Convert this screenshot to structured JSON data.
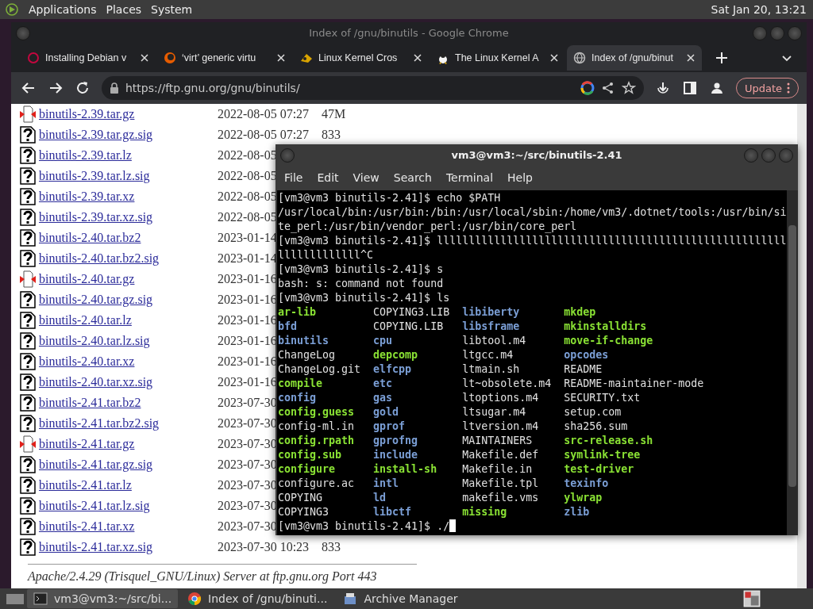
{
  "top_panel": {
    "menus": [
      "Applications",
      "Places",
      "System"
    ],
    "clock": "Sat Jan 20, 13:21"
  },
  "browser": {
    "title": "Index of /gnu/binutils - Google Chrome",
    "tabs": [
      {
        "label": "Installing Debian v",
        "selected": false
      },
      {
        "label": "‘virt’ generic virtu",
        "selected": false
      },
      {
        "label": "Linux Kernel Cros",
        "selected": false
      },
      {
        "label": "The Linux Kernel A",
        "selected": false
      },
      {
        "label": "Index of /gnu/binut",
        "selected": true
      }
    ],
    "address": "https://ftp.gnu.org/gnu/binutils/",
    "update_button": "Update",
    "listing": [
      {
        "name": "binutils-2.39.tar.gz",
        "kind": "archive",
        "date": "2022-08-05 07:27",
        "size": "47M"
      },
      {
        "name": "binutils-2.39.tar.gz.sig",
        "kind": "unknown",
        "date": "2022-08-05 07:27",
        "size": "833"
      },
      {
        "name": "binutils-2.39.tar.lz",
        "kind": "unknown",
        "date": "2022-08-05"
      },
      {
        "name": "binutils-2.39.tar.lz.sig",
        "kind": "unknown",
        "date": "2022-08-05"
      },
      {
        "name": "binutils-2.39.tar.xz",
        "kind": "unknown",
        "date": "2022-08-05"
      },
      {
        "name": "binutils-2.39.tar.xz.sig",
        "kind": "unknown",
        "date": "2022-08-05"
      },
      {
        "name": "binutils-2.40.tar.bz2",
        "kind": "unknown",
        "date": "2023-01-14"
      },
      {
        "name": "binutils-2.40.tar.bz2.sig",
        "kind": "unknown",
        "date": "2023-01-14"
      },
      {
        "name": "binutils-2.40.tar.gz",
        "kind": "archive",
        "date": "2023-01-16"
      },
      {
        "name": "binutils-2.40.tar.gz.sig",
        "kind": "unknown",
        "date": "2023-01-16"
      },
      {
        "name": "binutils-2.40.tar.lz",
        "kind": "unknown",
        "date": "2023-01-16"
      },
      {
        "name": "binutils-2.40.tar.lz.sig",
        "kind": "unknown",
        "date": "2023-01-16"
      },
      {
        "name": "binutils-2.40.tar.xz",
        "kind": "unknown",
        "date": "2023-01-16"
      },
      {
        "name": "binutils-2.40.tar.xz.sig",
        "kind": "unknown",
        "date": "2023-01-16"
      },
      {
        "name": "binutils-2.41.tar.bz2",
        "kind": "unknown",
        "date": "2023-07-30"
      },
      {
        "name": "binutils-2.41.tar.bz2.sig",
        "kind": "unknown",
        "date": "2023-07-30"
      },
      {
        "name": "binutils-2.41.tar.gz",
        "kind": "archive",
        "date": "2023-07-30"
      },
      {
        "name": "binutils-2.41.tar.gz.sig",
        "kind": "unknown",
        "date": "2023-07-30"
      },
      {
        "name": "binutils-2.41.tar.lz",
        "kind": "unknown",
        "date": "2023-07-30"
      },
      {
        "name": "binutils-2.41.tar.lz.sig",
        "kind": "unknown",
        "date": "2023-07-30"
      },
      {
        "name": "binutils-2.41.tar.xz",
        "kind": "unknown",
        "date": "2023-07-30"
      },
      {
        "name": "binutils-2.41.tar.xz.sig",
        "kind": "unknown",
        "date": "2023-07-30 10:23",
        "size": "833"
      }
    ],
    "footer": "Apache/2.4.29 (Trisquel_GNU/Linux) Server at ftp.gnu.org Port 443"
  },
  "terminal": {
    "title": "vm3@vm3:~/src/binutils-2.41",
    "menus": [
      "File",
      "Edit",
      "View",
      "Search",
      "Terminal",
      "Help"
    ],
    "lines": [
      "[vm3@vm3 binutils-2.41]$ echo $PATH",
      "/usr/local/bin:/usr/bin:/bin:/usr/local/sbin:/home/vm3/.dotnet/tools:/usr/bin/si",
      "te_perl:/usr/bin/vendor_perl:/usr/bin/core_perl",
      "[vm3@vm3 binutils-2.41]$ lllllllllllllllllllllllllllllllllllllllllllllllllllllll",
      "lllllllllllll^C",
      "[vm3@vm3 binutils-2.41]$ s",
      "bash: s: command not found",
      "[vm3@vm3 binutils-2.41]$ ls"
    ],
    "ls_rows": [
      [
        {
          "name": "ar-lib",
          "kind": "exec"
        },
        {
          "name": "COPYING3.LIB",
          "kind": "file"
        },
        {
          "name": "libiberty",
          "kind": "dir"
        },
        {
          "name": "mkdep",
          "kind": "exec"
        }
      ],
      [
        {
          "name": "bfd",
          "kind": "dir"
        },
        {
          "name": "COPYING.LIB",
          "kind": "file"
        },
        {
          "name": "libsframe",
          "kind": "dir"
        },
        {
          "name": "mkinstalldirs",
          "kind": "exec"
        }
      ],
      [
        {
          "name": "binutils",
          "kind": "dir"
        },
        {
          "name": "cpu",
          "kind": "dir"
        },
        {
          "name": "libtool.m4",
          "kind": "file"
        },
        {
          "name": "move-if-change",
          "kind": "exec"
        }
      ],
      [
        {
          "name": "ChangeLog",
          "kind": "file"
        },
        {
          "name": "depcomp",
          "kind": "exec"
        },
        {
          "name": "ltgcc.m4",
          "kind": "file"
        },
        {
          "name": "opcodes",
          "kind": "dir"
        }
      ],
      [
        {
          "name": "ChangeLog.git",
          "kind": "file"
        },
        {
          "name": "elfcpp",
          "kind": "dir"
        },
        {
          "name": "ltmain.sh",
          "kind": "file"
        },
        {
          "name": "README",
          "kind": "file"
        }
      ],
      [
        {
          "name": "compile",
          "kind": "exec"
        },
        {
          "name": "etc",
          "kind": "dir"
        },
        {
          "name": "lt~obsolete.m4",
          "kind": "file"
        },
        {
          "name": "README-maintainer-mode",
          "kind": "file"
        }
      ],
      [
        {
          "name": "config",
          "kind": "dir"
        },
        {
          "name": "gas",
          "kind": "dir"
        },
        {
          "name": "ltoptions.m4",
          "kind": "file"
        },
        {
          "name": "SECURITY.txt",
          "kind": "file"
        }
      ],
      [
        {
          "name": "config.guess",
          "kind": "exec"
        },
        {
          "name": "gold",
          "kind": "dir"
        },
        {
          "name": "ltsugar.m4",
          "kind": "file"
        },
        {
          "name": "setup.com",
          "kind": "file"
        }
      ],
      [
        {
          "name": "config-ml.in",
          "kind": "file"
        },
        {
          "name": "gprof",
          "kind": "dir"
        },
        {
          "name": "ltversion.m4",
          "kind": "file"
        },
        {
          "name": "sha256.sum",
          "kind": "file"
        }
      ],
      [
        {
          "name": "config.rpath",
          "kind": "exec"
        },
        {
          "name": "gprofng",
          "kind": "dir"
        },
        {
          "name": "MAINTAINERS",
          "kind": "file"
        },
        {
          "name": "src-release.sh",
          "kind": "exec"
        }
      ],
      [
        {
          "name": "config.sub",
          "kind": "exec"
        },
        {
          "name": "include",
          "kind": "dir"
        },
        {
          "name": "Makefile.def",
          "kind": "file"
        },
        {
          "name": "symlink-tree",
          "kind": "exec"
        }
      ],
      [
        {
          "name": "configure",
          "kind": "exec"
        },
        {
          "name": "install-sh",
          "kind": "exec"
        },
        {
          "name": "Makefile.in",
          "kind": "file"
        },
        {
          "name": "test-driver",
          "kind": "exec"
        }
      ],
      [
        {
          "name": "configure.ac",
          "kind": "file"
        },
        {
          "name": "intl",
          "kind": "dir"
        },
        {
          "name": "Makefile.tpl",
          "kind": "file"
        },
        {
          "name": "texinfo",
          "kind": "dir"
        }
      ],
      [
        {
          "name": "COPYING",
          "kind": "file"
        },
        {
          "name": "ld",
          "kind": "dir"
        },
        {
          "name": "makefile.vms",
          "kind": "file"
        },
        {
          "name": "ylwrap",
          "kind": "exec"
        }
      ],
      [
        {
          "name": "COPYING3",
          "kind": "file"
        },
        {
          "name": "libctf",
          "kind": "dir"
        },
        {
          "name": "missing",
          "kind": "exec"
        },
        {
          "name": "zlib",
          "kind": "dir"
        }
      ]
    ],
    "prompt": "[vm3@vm3 binutils-2.41]$ ./"
  },
  "taskbar": {
    "items": [
      {
        "label": "vm3@vm3:~/src/bi...",
        "selected": true
      },
      {
        "label": "Index of /gnu/binuti...",
        "selected": false
      },
      {
        "label": "Archive Manager",
        "selected": false
      }
    ]
  }
}
